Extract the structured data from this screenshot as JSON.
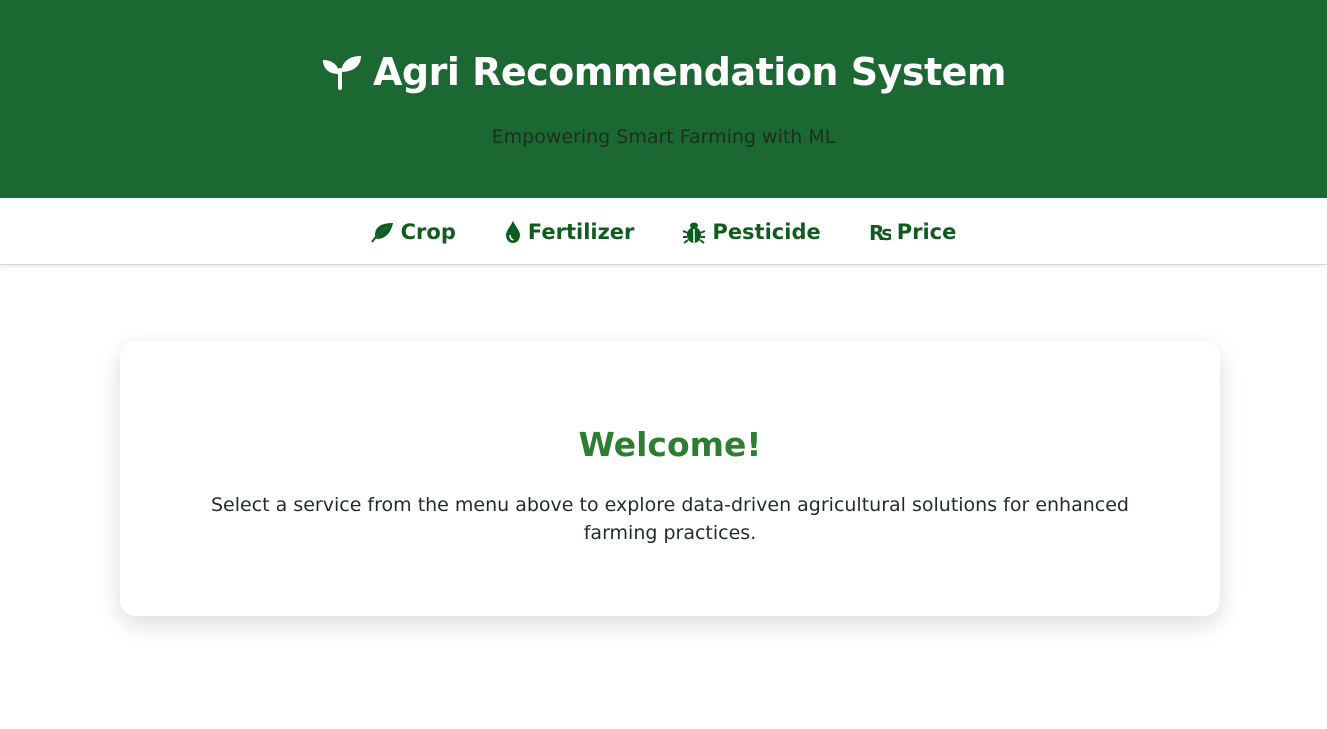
{
  "header": {
    "title": "Agri Recommendation System",
    "subtitle": "Empowering Smart Farming with ML",
    "icon": "seedling-icon",
    "background_color": "#1b6833"
  },
  "nav": {
    "items": [
      {
        "label": "Crop",
        "icon": "leaf-icon"
      },
      {
        "label": "Fertilizer",
        "icon": "droplet-icon"
      },
      {
        "label": "Pesticide",
        "icon": "bug-icon"
      },
      {
        "label": "Price",
        "icon": "rupee-icon"
      }
    ],
    "color": "#0f5c1e"
  },
  "welcome": {
    "title": "Welcome!",
    "text": "Select a service from the menu above to explore data-driven agricultural solutions for enhanced farming practices.",
    "title_color": "#2e7d32"
  }
}
